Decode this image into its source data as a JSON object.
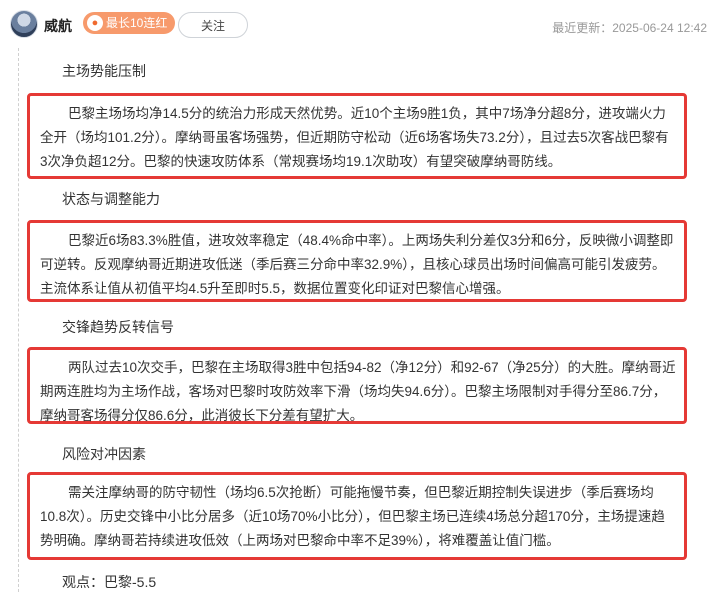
{
  "header": {
    "author": "威航",
    "badge_label": "最长10连红",
    "badge_icon": "flame-icon",
    "follow_label": "关注",
    "updated_label": "最近更新：2025-06-24 12:42"
  },
  "sections": [
    {
      "heading": "主场势能压制",
      "body": "巴黎主场场均净14.5分的统治力形成天然优势。近10个主场9胜1负，其中7场净分超8分，进攻端火力全开（场均101.2分）。摩纳哥虽客场强势，但近期防守松动（近6场客场失73.2分），且过去5次客战巴黎有3次净负超12分。巴黎的快速攻防体系（常规赛场均19.1次助攻）有望突破摩纳哥防线。"
    },
    {
      "heading": "状态与调整能力",
      "body": "巴黎近6场83.3%胜值，进攻效率稳定（48.4%命中率）。上两场失利分差仅3分和6分，反映微小调整即可逆转。反观摩纳哥近期进攻低迷（季后赛三分命中率32.9%），且核心球员出场时间偏高可能引发疲劳。主流体系让值从初值平均4.5升至即时5.5，数据位置变化印证对巴黎信心增强。"
    },
    {
      "heading": "交锋趋势反转信号",
      "body": "两队过去10次交手，巴黎在主场取得3胜中包括94-82（净12分）和92-67（净25分）的大胜。摩纳哥近期两连胜均为主场作战，客场对巴黎时攻防效率下滑（场均失94.6分）。巴黎主场限制对手得分至86.7分，摩纳哥客场得分仅86.6分，此消彼长下分差有望扩大。"
    },
    {
      "heading": "风险对冲因素",
      "body": "需关注摩纳哥的防守韧性（场均6.5次抢断）可能拖慢节奏，但巴黎近期控制失误进步（季后赛场均10.8次）。历史交锋中小比分居多（近10场70%小比分），但巴黎主场已连续4场总分超170分，主场提速趋势明确。摩纳哥若持续进攻低效（上两场对巴黎命中率不足39%），将难覆盖让值门槛。"
    }
  ],
  "viewpoint": "观点：巴黎-5.5"
}
